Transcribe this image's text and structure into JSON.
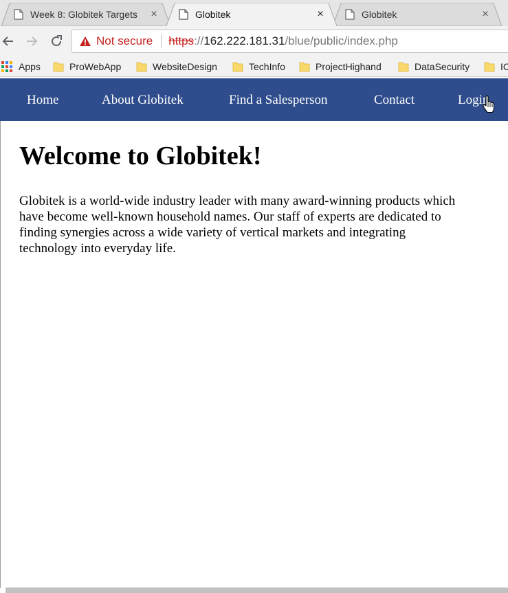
{
  "browser": {
    "tabs": [
      {
        "title": "Week 8: Globitek Targets",
        "active": false
      },
      {
        "title": "Globitek",
        "active": true
      },
      {
        "title": "Globitek",
        "active": false
      }
    ],
    "close_glyph": "×",
    "address": {
      "warning": "Not secure",
      "scheme": "https",
      "scheme_sep": "://",
      "host": "162.222.181.31",
      "path": "/blue/public/index.php"
    },
    "bookmarks": [
      {
        "label": "Apps",
        "icon": "apps-grid-icon"
      },
      {
        "label": "ProWebApp",
        "icon": "folder-icon"
      },
      {
        "label": "WebsiteDesign",
        "icon": "folder-icon"
      },
      {
        "label": "TechInfo",
        "icon": "folder-icon"
      },
      {
        "label": "ProjectHighand",
        "icon": "folder-icon"
      },
      {
        "label": "DataSecurity",
        "icon": "folder-icon"
      },
      {
        "label": "IC",
        "icon": "folder-icon"
      }
    ]
  },
  "site": {
    "nav": [
      "Home",
      "About Globitek",
      "Find a Salesperson",
      "Contact",
      "Login"
    ],
    "heading": "Welcome to Globitek!",
    "intro": "Globitek is a world-wide industry leader with many award-winning products which have become well-known household names. Our staff of experts are dedicated to finding synergies across a wide variety of vertical markets and integrating technology into everyday life."
  },
  "colors": {
    "nav_bg": "#2f4d8c",
    "warning_red": "#c5221f",
    "folder_yellow": "#f9d96b"
  }
}
